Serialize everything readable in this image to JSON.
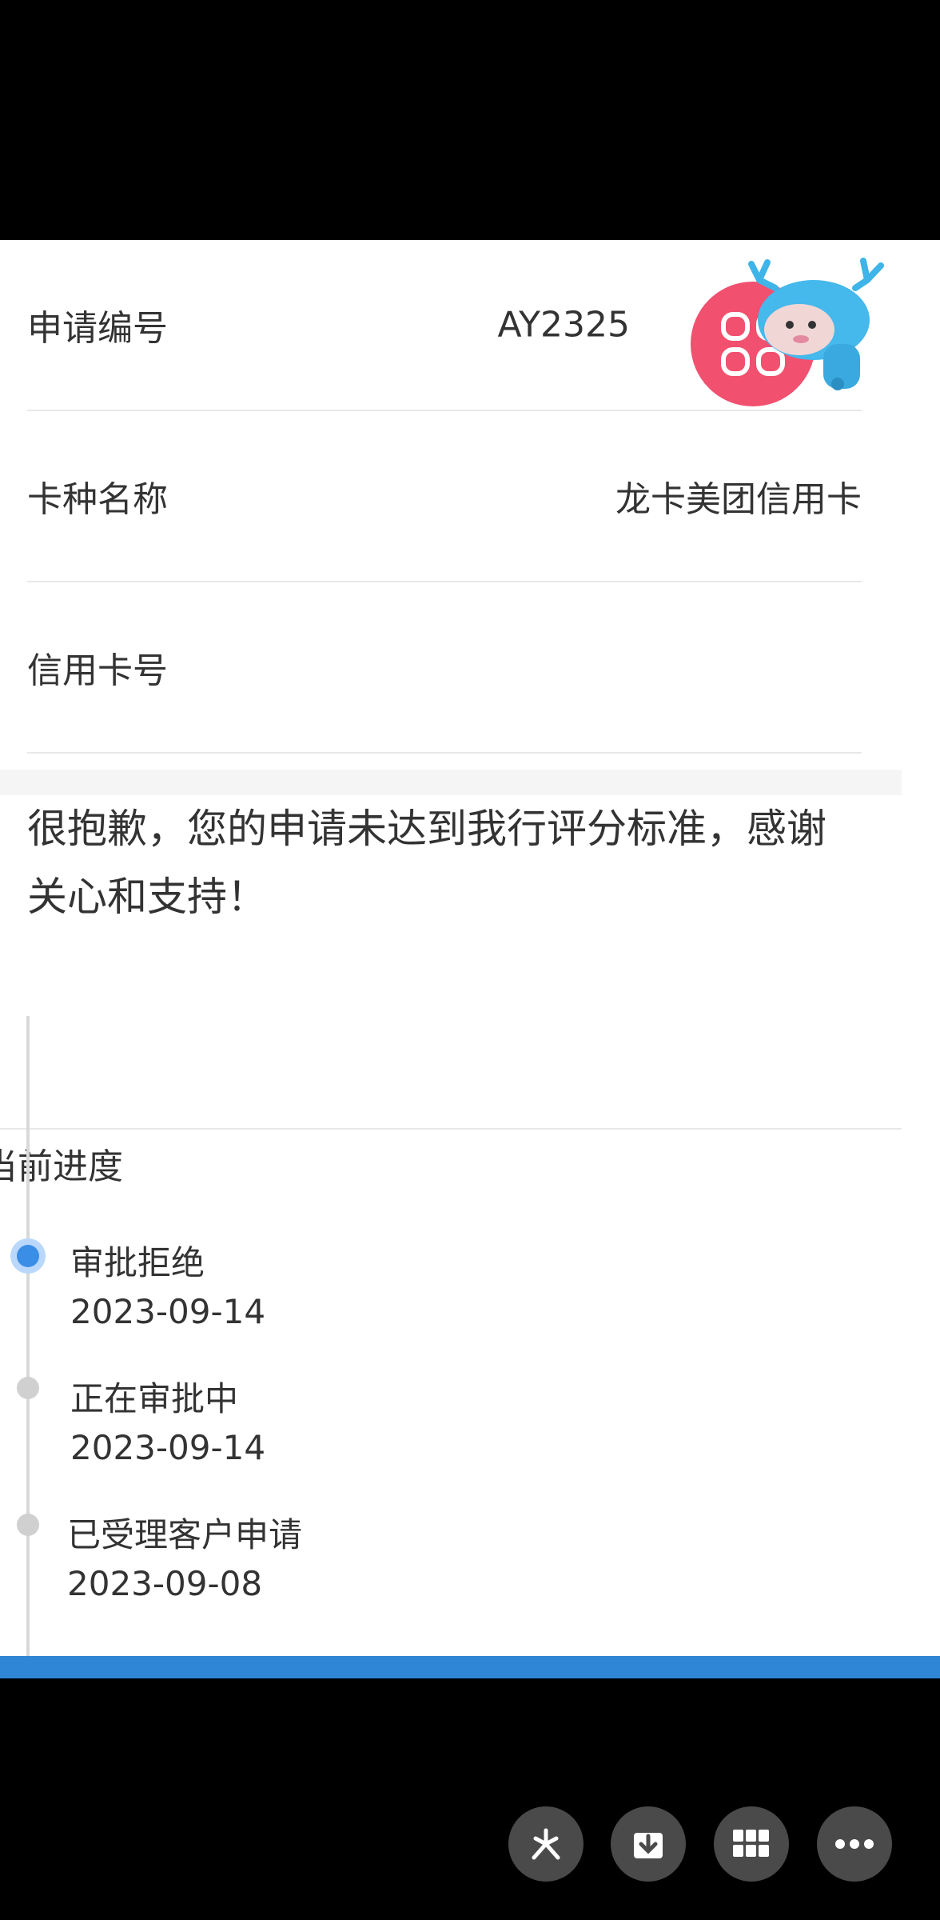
{
  "fields": [
    {
      "label": "申请编号",
      "value": "AY2325"
    },
    {
      "label": "卡种名称",
      "value": "龙卡美团信用卡"
    },
    {
      "label": "信用卡号",
      "value": ""
    }
  ],
  "message": "很抱歉，您的申请未达到我行评分标准，感谢关心和支持！",
  "progress": {
    "title": "当前进度",
    "steps": [
      {
        "status": "审批拒绝",
        "date": "2023-09-14",
        "active": true
      },
      {
        "status": "正在审批中",
        "date": "2023-09-14",
        "active": false
      },
      {
        "status": "已受理客户申请",
        "date": "2023-09-08",
        "active": false
      }
    ]
  },
  "icons": {
    "float_button": "grid-menu-icon",
    "mascot": "deer-mascot-icon",
    "toolbar": [
      "sparkle-icon",
      "download-icon",
      "apps-grid-icon",
      "more-icon"
    ]
  },
  "colors": {
    "accent_blue": "#3a8ee6",
    "float_pink": "#f2506f",
    "bottom_bar": "#2f86d6"
  }
}
